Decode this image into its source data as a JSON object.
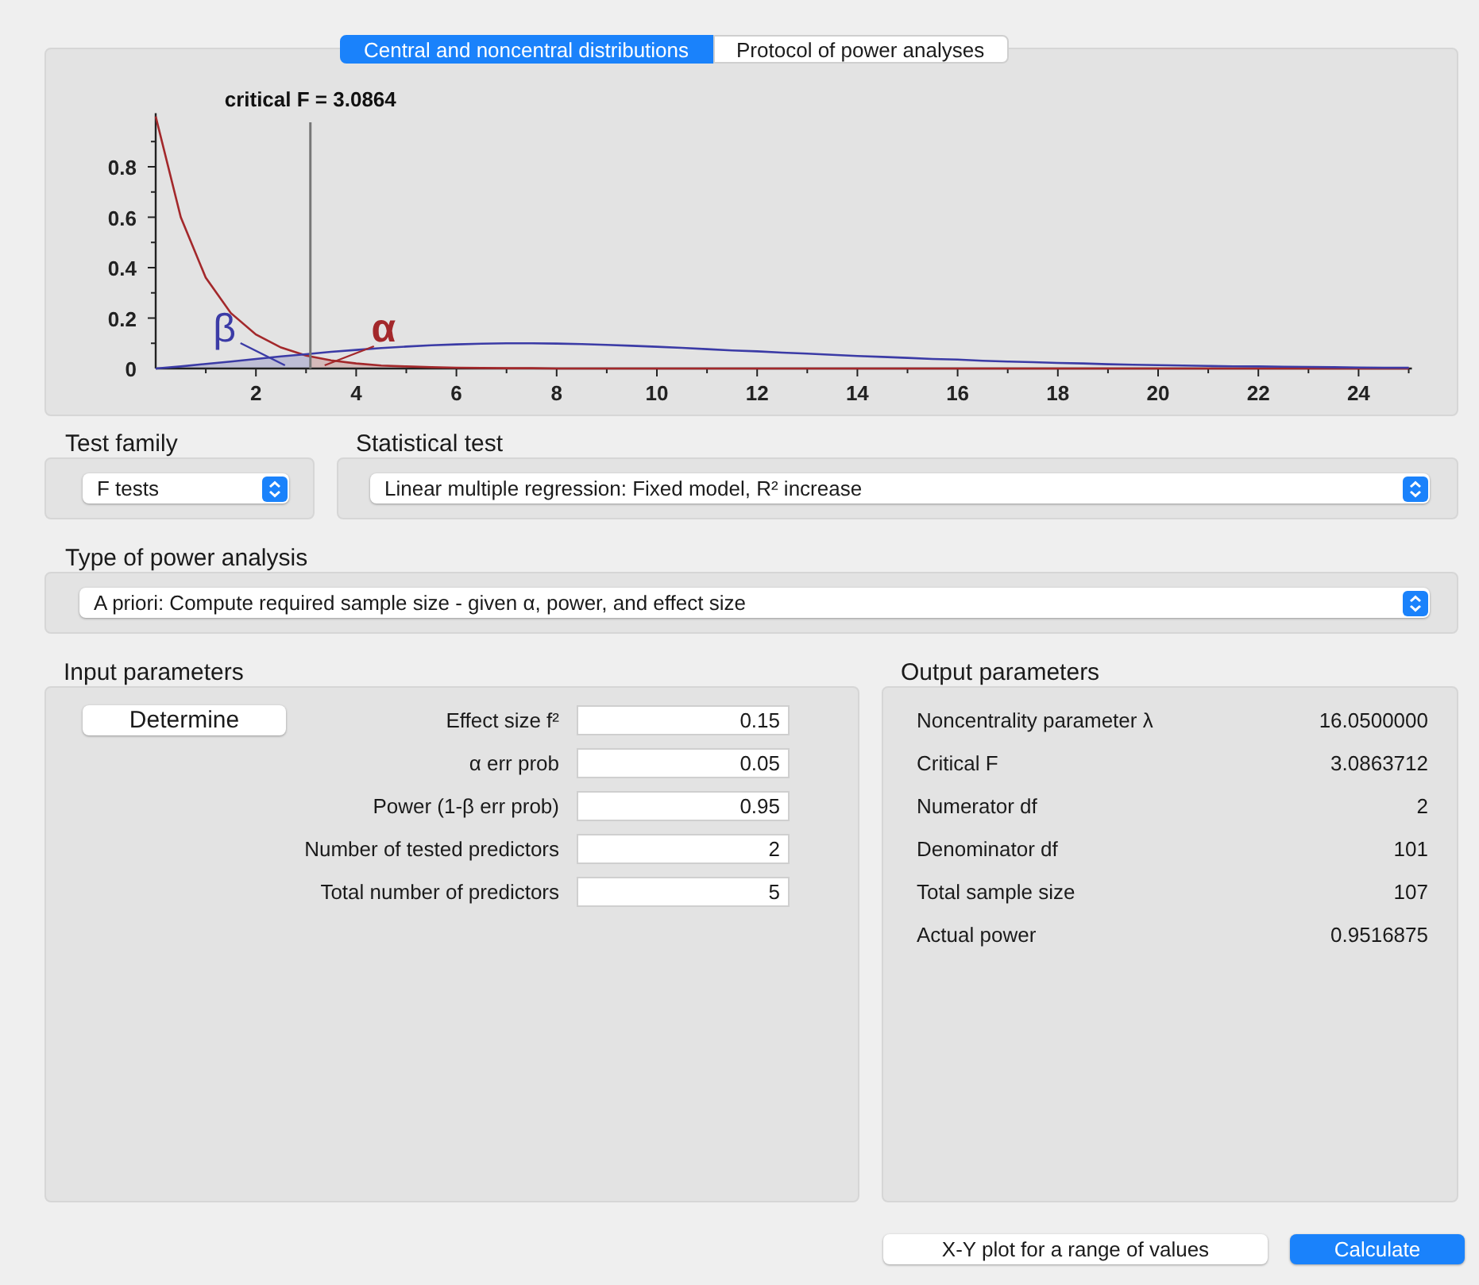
{
  "tabs": [
    {
      "label": "Central and noncentral distributions",
      "selected": true
    },
    {
      "label": "Protocol of power analyses",
      "selected": false
    }
  ],
  "chart": {
    "chart_data": {
      "type": "line",
      "x": [
        0,
        0.5,
        1,
        1.5,
        2,
        2.5,
        3,
        3.5,
        4,
        4.5,
        5,
        5.5,
        6,
        6.5,
        7,
        7.5,
        8,
        8.5,
        9,
        9.5,
        10,
        10.5,
        11,
        11.5,
        12,
        12.5,
        13,
        13.5,
        14,
        14.5,
        15,
        15.5,
        16,
        16.5,
        17,
        17.5,
        18,
        18.5,
        19,
        19.5,
        20,
        20.5,
        21,
        21.5,
        22,
        22.5,
        23,
        23.5,
        24,
        24.5,
        25
      ],
      "series": [
        {
          "color": "#a3282b",
          "values": [
            1,
            0.6,
            0.36,
            0.22,
            0.135,
            0.083,
            0.051,
            0.032,
            0.02,
            0.012,
            0.008,
            0.005,
            0.003,
            0.002,
            0.001,
            0.001,
            0,
            0,
            0,
            0,
            0,
            0,
            0,
            0,
            0,
            0,
            0,
            0,
            0,
            0,
            0,
            0,
            0,
            0,
            0,
            0,
            0,
            0,
            0,
            0,
            0,
            0,
            0,
            0,
            0,
            0,
            0,
            0,
            0,
            0,
            0
          ]
        },
        {
          "color": "#3b3ba6",
          "values": [
            0,
            0.008,
            0.018,
            0.028,
            0.038,
            0.048,
            0.057,
            0.066,
            0.074,
            0.081,
            0.087,
            0.092,
            0.096,
            0.098,
            0.1,
            0.1,
            0.099,
            0.097,
            0.094,
            0.09,
            0.086,
            0.082,
            0.077,
            0.072,
            0.068,
            0.063,
            0.059,
            0.054,
            0.05,
            0.046,
            0.042,
            0.038,
            0.035,
            0.031,
            0.028,
            0.025,
            0.022,
            0.02,
            0.017,
            0.015,
            0.013,
            0.012,
            0.01,
            0.009,
            0.008,
            0.007,
            0.006,
            0.005,
            0.004,
            0.003,
            0.003
          ]
        }
      ],
      "xlim": [
        0,
        25
      ],
      "ylim": [
        0,
        1
      ],
      "xticks": [
        2,
        4,
        6,
        8,
        10,
        12,
        14,
        16,
        18,
        20,
        22,
        24
      ],
      "yticks": [
        0,
        0.2,
        0.4,
        0.6,
        0.8
      ],
      "ref_lines": [
        {
          "axis": "x",
          "value": 3.0864,
          "label": "critical F = 3.0864"
        }
      ],
      "annotations": [
        "β",
        "α"
      ]
    }
  },
  "test_family": {
    "label": "Test family",
    "value": "F tests"
  },
  "statistical_test": {
    "label": "Statistical test",
    "value": "Linear multiple regression: Fixed model, R² increase"
  },
  "type_of_power_analysis": {
    "label": "Type of power analysis",
    "value": "A priori: Compute required sample size - given α, power, and effect size"
  },
  "input_parameters": {
    "title": "Input parameters",
    "determine_button": "Determine",
    "fields": [
      {
        "label": "Effect size f²",
        "value": "0.15"
      },
      {
        "label": "α err prob",
        "value": "0.05"
      },
      {
        "label": "Power (1-β err prob)",
        "value": "0.95"
      },
      {
        "label": "Number of tested predictors",
        "value": "2"
      },
      {
        "label": "Total number of predictors",
        "value": "5"
      }
    ]
  },
  "output_parameters": {
    "title": "Output parameters",
    "rows": [
      {
        "label": "Noncentrality parameter λ",
        "value": "16.0500000"
      },
      {
        "label": "Critical F",
        "value": "3.0863712"
      },
      {
        "label": "Numerator df",
        "value": "2"
      },
      {
        "label": "Denominator df",
        "value": "101"
      },
      {
        "label": "Total sample size",
        "value": "107"
      },
      {
        "label": "Actual power",
        "value": "0.9516875"
      }
    ]
  },
  "buttons": [
    {
      "label": "X-Y plot for a range of values",
      "kind": "secondary"
    },
    {
      "label": "Calculate",
      "kind": "primary"
    }
  ]
}
